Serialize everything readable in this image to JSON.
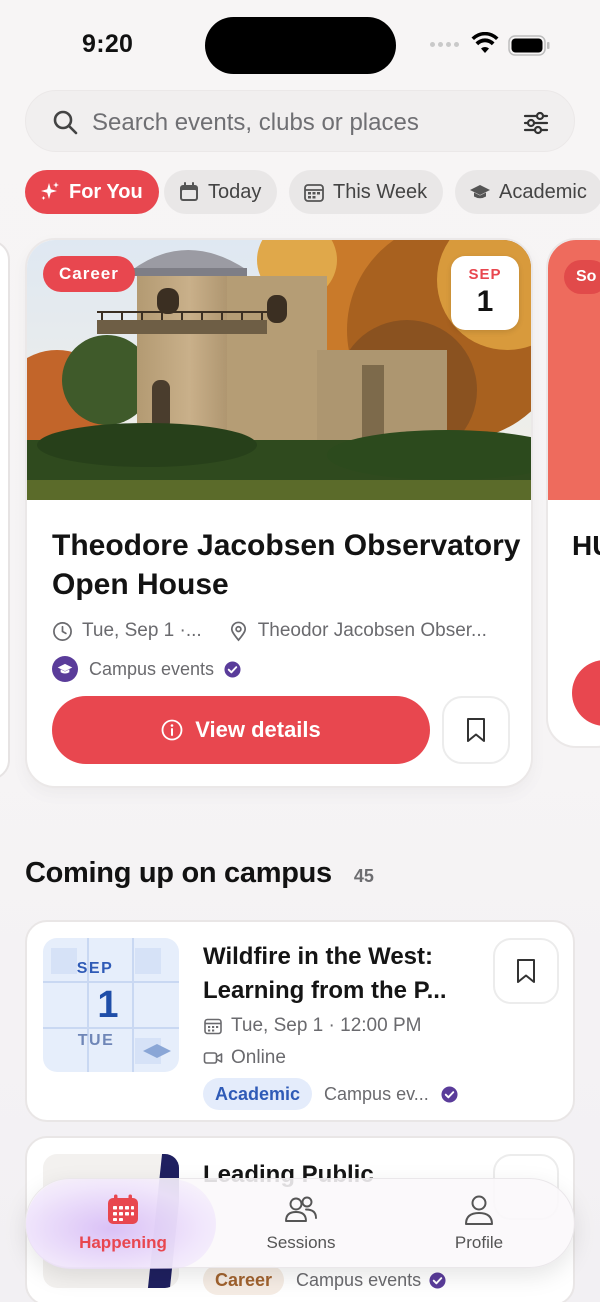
{
  "status": {
    "time": "9:20"
  },
  "search": {
    "placeholder": "Search events, clubs or places"
  },
  "chips": [
    {
      "label": "For You",
      "icon": "sparkles-icon",
      "active": true
    },
    {
      "label": "Today",
      "icon": "calendar-icon",
      "active": false
    },
    {
      "label": "This Week",
      "icon": "calendar-week-icon",
      "active": false
    },
    {
      "label": "Academic",
      "icon": "graduation-cap-icon",
      "active": false
    }
  ],
  "featured": {
    "tag": "Career",
    "date_month": "SEP",
    "date_day": "1",
    "title": "Theodore Jacobsen Observatory Open House",
    "time": "Tue, Sep 1 ·...",
    "location": "Theodor Jacobsen Obser...",
    "organizer": "Campus events",
    "view_label": "View details"
  },
  "peek": {
    "tag": "So",
    "title": "HU"
  },
  "section": {
    "title": "Coming up on campus",
    "count": "45"
  },
  "events": [
    {
      "month": "SEP",
      "day": "1",
      "weekday": "TUE",
      "title": "Wildfire in the West: Learning from the P...",
      "datetime": "Tue, Sep 1 · 12:00 PM",
      "mode": "Online",
      "category": "Academic",
      "organizer": "Campus ev..."
    },
    {
      "title": "Leading Public",
      "category": "Career",
      "organizer": "Campus events"
    }
  ],
  "tabs": [
    {
      "label": "Happening",
      "icon": "calendar-grid-icon",
      "active": true
    },
    {
      "label": "Sessions",
      "icon": "people-icon",
      "active": false
    },
    {
      "label": "Profile",
      "icon": "person-icon",
      "active": false
    }
  ],
  "colors": {
    "accent": "#e8474f",
    "academic": "#2f5bb7",
    "org_purple": "#5a3c9a",
    "career_tag": "#a0622e"
  }
}
